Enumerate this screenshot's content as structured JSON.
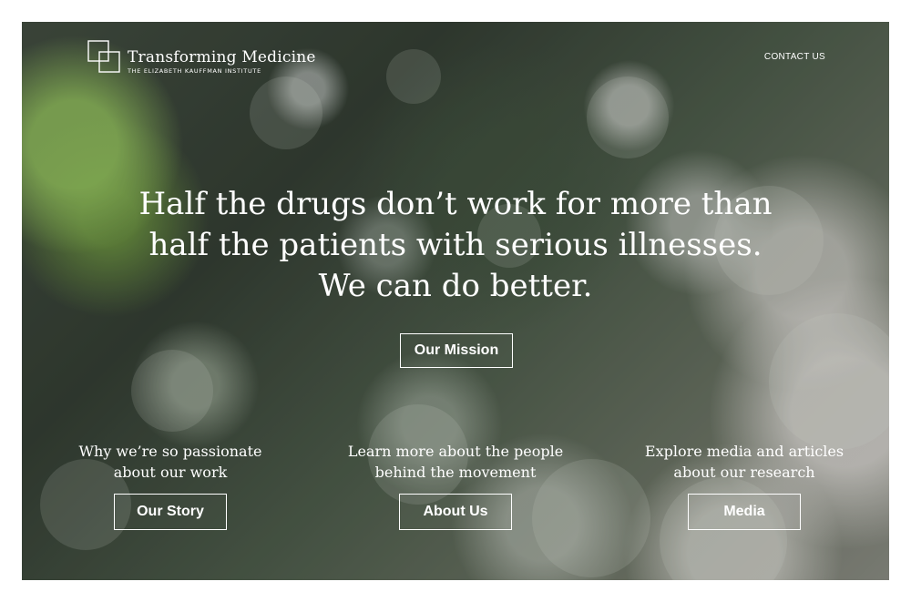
{
  "header": {
    "logo_title": "Transforming Medicine",
    "logo_subtitle": "THE ELIZABETH KAUFFMAN INSTITUTE",
    "logo_icon": "overlapping-squares-icon",
    "contact_label": "CONTACT US"
  },
  "hero": {
    "headline_lines": [
      "Half the drugs don’t work for more than",
      "half the patients with serious illnesses.",
      "We can do better."
    ],
    "mission_button": "Our Mission"
  },
  "columns": [
    {
      "text_lines": [
        "Why we’re so passionate",
        "about our work"
      ],
      "button": "Our Story"
    },
    {
      "text_lines": [
        "Learn more about the people",
        "behind the movement"
      ],
      "button": "About Us"
    },
    {
      "text_lines": [
        "Explore media and articles",
        "about our research"
      ],
      "button": "Media"
    }
  ],
  "colors": {
    "text": "#ffffff",
    "border": "#ffffff",
    "page_background": "#ffffff"
  }
}
